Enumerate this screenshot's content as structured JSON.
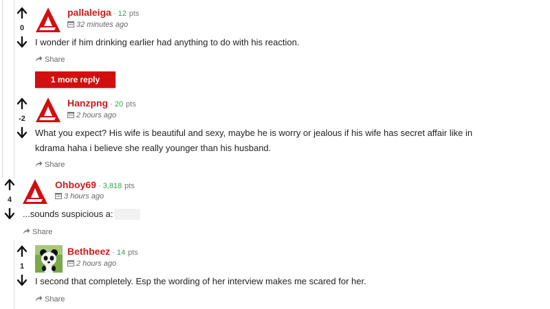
{
  "comments": [
    {
      "username": "pallaleiga",
      "points": "12",
      "pts_label": "pts",
      "time": "32 minutes ago",
      "votes": "0",
      "body": "I wonder if him drinking earlier had anything to do with his reaction.",
      "share_label": "Share",
      "more_reply_label": "1 more reply",
      "avatar": "red-a-logo-icon"
    },
    {
      "username": "Hanzpng",
      "points": "20",
      "pts_label": "pts",
      "time": "2 hours ago",
      "votes": "-2",
      "body_lines": [
        "What you expect? His wife is beautiful and sexy, maybe he is worry or jealous if his wife has secret affair like in",
        "kdrama haha i believe she really younger than his husband."
      ],
      "share_label": "Share",
      "avatar": "red-a-logo-icon"
    },
    {
      "username": "Ohboy69",
      "points": "3,818",
      "pts_label": "pts",
      "time": "3 hours ago",
      "votes": "4",
      "body": "...sounds suspicious a:",
      "share_label": "Share",
      "avatar": "red-a-logo-icon"
    },
    {
      "username": "Bethbeez",
      "points": "14",
      "pts_label": "pts",
      "time": "2 hours ago",
      "votes": "1",
      "body": "I second that completely. Esp the wording of her interview makes me scared for her.",
      "share_label": "Share",
      "avatar": "panda-avatar-icon"
    }
  ],
  "colors": {
    "username": "#cc1b1b",
    "points": "#2ea44f",
    "button": "#d20f0f"
  }
}
